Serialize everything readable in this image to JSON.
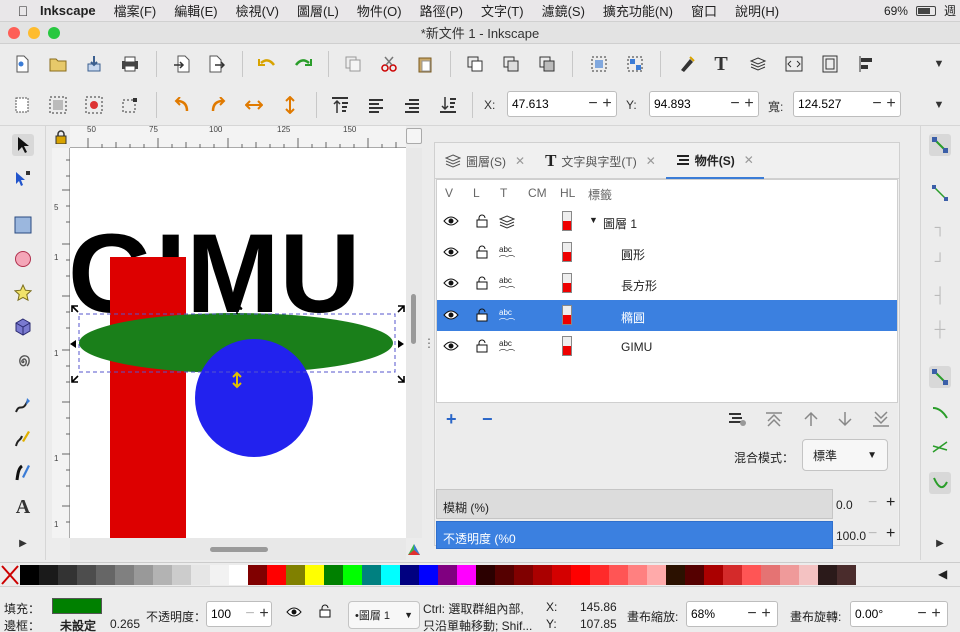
{
  "menubar": {
    "app": "Inkscape",
    "items": [
      "檔案(F)",
      "編輯(E)",
      "檢視(V)",
      "圖層(L)",
      "物件(O)",
      "路徑(P)",
      "文字(T)",
      "濾鏡(S)",
      "擴充功能(N)",
      "窗口",
      "說明(H)"
    ],
    "battery": "69%",
    "extra": "週"
  },
  "window": {
    "title": "*新文件 1 - Inkscape"
  },
  "toolbar2": {
    "x_label": "X:",
    "x_value": "47.613",
    "y_label": "Y:",
    "y_value": "94.893",
    "w_label": "寬:",
    "w_value": "124.527"
  },
  "ruler": {
    "top_ticks": [
      "50",
      "75",
      "100",
      "125",
      "150"
    ],
    "left_ticks": [
      "5",
      "1",
      "1",
      "1",
      "1"
    ]
  },
  "canvas": {
    "text": "GIMU",
    "colors": {
      "rect": "#dd0000",
      "ellipse": "#1a7f1a",
      "circle": "#2222ee",
      "text": "#000000",
      "selection": "#5555cc"
    }
  },
  "dock": {
    "tabs": [
      {
        "label": "圖層(S)",
        "icon": "layers-icon"
      },
      {
        "label": "文字與字型(T)",
        "icon": "text-icon"
      },
      {
        "label": "物件(S)",
        "icon": "objects-icon"
      }
    ],
    "columns": [
      "V",
      "L",
      "T",
      "CM",
      "HL",
      "標籤"
    ],
    "objects": [
      {
        "label": "圖層 1",
        "type": "layer",
        "selected": false
      },
      {
        "label": "圓形",
        "type": "abc",
        "selected": false
      },
      {
        "label": "長方形",
        "type": "abc",
        "selected": false
      },
      {
        "label": "橢圓",
        "type": "abc",
        "selected": true
      },
      {
        "label": "GIMU",
        "type": "abc",
        "selected": false
      }
    ],
    "add": "+",
    "remove": "−",
    "blend_label": "混合模式：",
    "blend_value": "標準",
    "blur_label": "模糊 (%)",
    "blur_value": "0.0",
    "opacity_label": "不透明度 (%0",
    "opacity_value": "100.0"
  },
  "palette": {
    "colors": [
      "#000000",
      "#1a1a1a",
      "#333333",
      "#4d4d4d",
      "#666666",
      "#808080",
      "#999999",
      "#b3b3b3",
      "#cccccc",
      "#e6e6e6",
      "#f2f2f2",
      "#ffffff",
      "#800000",
      "#ff0000",
      "#808000",
      "#ffff00",
      "#008000",
      "#00ff00",
      "#008080",
      "#00ffff",
      "#000080",
      "#0000ff",
      "#800080",
      "#ff00ff",
      "#2b0000",
      "#550000",
      "#800000",
      "#aa0000",
      "#d40000",
      "#ff0000",
      "#ff2a2a",
      "#ff5555",
      "#ff8080",
      "#ffaaaa",
      "#2b1100",
      "#550000",
      "#aa0000",
      "#d42a2a",
      "#ff5555",
      "#e57373",
      "#ef9a9a",
      "#f4c2c2",
      "#2b1a1a",
      "#4a2c2c"
    ]
  },
  "statusbar": {
    "fill_label": "填充：",
    "fill_color": "#008000",
    "stroke_label": "邊框：",
    "stroke_value": "未設定",
    "stroke_width": "0.265",
    "opacity_label": "不透明度：",
    "opacity_value": "100",
    "layer": "•圖層 1",
    "msg1": "Ctrl: 選取群組內部,",
    "msg1_bold": "Ctrl",
    "msg2": "只沿單軸移動; Shif...",
    "x_label": "X:",
    "x_value": "145.86",
    "y_label": "Y:",
    "y_value": "107.85",
    "zoom_label": "畫布縮放:",
    "zoom_value": "68%",
    "rotate_label": "畫布旋轉:",
    "rotate_value": "0.00°"
  }
}
